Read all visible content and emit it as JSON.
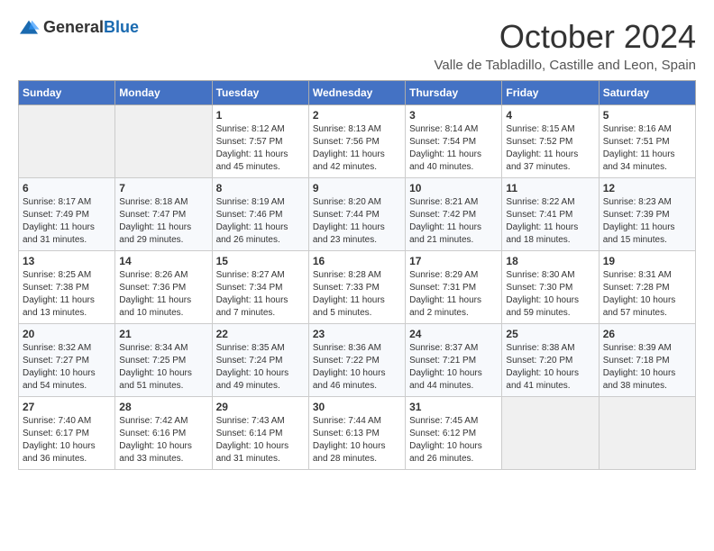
{
  "header": {
    "logo_general": "General",
    "logo_blue": "Blue",
    "title": "October 2024",
    "subtitle": "Valle de Tabladillo, Castille and Leon, Spain"
  },
  "weekdays": [
    "Sunday",
    "Monday",
    "Tuesday",
    "Wednesday",
    "Thursday",
    "Friday",
    "Saturday"
  ],
  "weeks": [
    [
      {
        "day": "",
        "text": ""
      },
      {
        "day": "",
        "text": ""
      },
      {
        "day": "1",
        "text": "Sunrise: 8:12 AM\nSunset: 7:57 PM\nDaylight: 11 hours and 45 minutes."
      },
      {
        "day": "2",
        "text": "Sunrise: 8:13 AM\nSunset: 7:56 PM\nDaylight: 11 hours and 42 minutes."
      },
      {
        "day": "3",
        "text": "Sunrise: 8:14 AM\nSunset: 7:54 PM\nDaylight: 11 hours and 40 minutes."
      },
      {
        "day": "4",
        "text": "Sunrise: 8:15 AM\nSunset: 7:52 PM\nDaylight: 11 hours and 37 minutes."
      },
      {
        "day": "5",
        "text": "Sunrise: 8:16 AM\nSunset: 7:51 PM\nDaylight: 11 hours and 34 minutes."
      }
    ],
    [
      {
        "day": "6",
        "text": "Sunrise: 8:17 AM\nSunset: 7:49 PM\nDaylight: 11 hours and 31 minutes."
      },
      {
        "day": "7",
        "text": "Sunrise: 8:18 AM\nSunset: 7:47 PM\nDaylight: 11 hours and 29 minutes."
      },
      {
        "day": "8",
        "text": "Sunrise: 8:19 AM\nSunset: 7:46 PM\nDaylight: 11 hours and 26 minutes."
      },
      {
        "day": "9",
        "text": "Sunrise: 8:20 AM\nSunset: 7:44 PM\nDaylight: 11 hours and 23 minutes."
      },
      {
        "day": "10",
        "text": "Sunrise: 8:21 AM\nSunset: 7:42 PM\nDaylight: 11 hours and 21 minutes."
      },
      {
        "day": "11",
        "text": "Sunrise: 8:22 AM\nSunset: 7:41 PM\nDaylight: 11 hours and 18 minutes."
      },
      {
        "day": "12",
        "text": "Sunrise: 8:23 AM\nSunset: 7:39 PM\nDaylight: 11 hours and 15 minutes."
      }
    ],
    [
      {
        "day": "13",
        "text": "Sunrise: 8:25 AM\nSunset: 7:38 PM\nDaylight: 11 hours and 13 minutes."
      },
      {
        "day": "14",
        "text": "Sunrise: 8:26 AM\nSunset: 7:36 PM\nDaylight: 11 hours and 10 minutes."
      },
      {
        "day": "15",
        "text": "Sunrise: 8:27 AM\nSunset: 7:34 PM\nDaylight: 11 hours and 7 minutes."
      },
      {
        "day": "16",
        "text": "Sunrise: 8:28 AM\nSunset: 7:33 PM\nDaylight: 11 hours and 5 minutes."
      },
      {
        "day": "17",
        "text": "Sunrise: 8:29 AM\nSunset: 7:31 PM\nDaylight: 11 hours and 2 minutes."
      },
      {
        "day": "18",
        "text": "Sunrise: 8:30 AM\nSunset: 7:30 PM\nDaylight: 10 hours and 59 minutes."
      },
      {
        "day": "19",
        "text": "Sunrise: 8:31 AM\nSunset: 7:28 PM\nDaylight: 10 hours and 57 minutes."
      }
    ],
    [
      {
        "day": "20",
        "text": "Sunrise: 8:32 AM\nSunset: 7:27 PM\nDaylight: 10 hours and 54 minutes."
      },
      {
        "day": "21",
        "text": "Sunrise: 8:34 AM\nSunset: 7:25 PM\nDaylight: 10 hours and 51 minutes."
      },
      {
        "day": "22",
        "text": "Sunrise: 8:35 AM\nSunset: 7:24 PM\nDaylight: 10 hours and 49 minutes."
      },
      {
        "day": "23",
        "text": "Sunrise: 8:36 AM\nSunset: 7:22 PM\nDaylight: 10 hours and 46 minutes."
      },
      {
        "day": "24",
        "text": "Sunrise: 8:37 AM\nSunset: 7:21 PM\nDaylight: 10 hours and 44 minutes."
      },
      {
        "day": "25",
        "text": "Sunrise: 8:38 AM\nSunset: 7:20 PM\nDaylight: 10 hours and 41 minutes."
      },
      {
        "day": "26",
        "text": "Sunrise: 8:39 AM\nSunset: 7:18 PM\nDaylight: 10 hours and 38 minutes."
      }
    ],
    [
      {
        "day": "27",
        "text": "Sunrise: 7:40 AM\nSunset: 6:17 PM\nDaylight: 10 hours and 36 minutes."
      },
      {
        "day": "28",
        "text": "Sunrise: 7:42 AM\nSunset: 6:16 PM\nDaylight: 10 hours and 33 minutes."
      },
      {
        "day": "29",
        "text": "Sunrise: 7:43 AM\nSunset: 6:14 PM\nDaylight: 10 hours and 31 minutes."
      },
      {
        "day": "30",
        "text": "Sunrise: 7:44 AM\nSunset: 6:13 PM\nDaylight: 10 hours and 28 minutes."
      },
      {
        "day": "31",
        "text": "Sunrise: 7:45 AM\nSunset: 6:12 PM\nDaylight: 10 hours and 26 minutes."
      },
      {
        "day": "",
        "text": ""
      },
      {
        "day": "",
        "text": ""
      }
    ]
  ]
}
